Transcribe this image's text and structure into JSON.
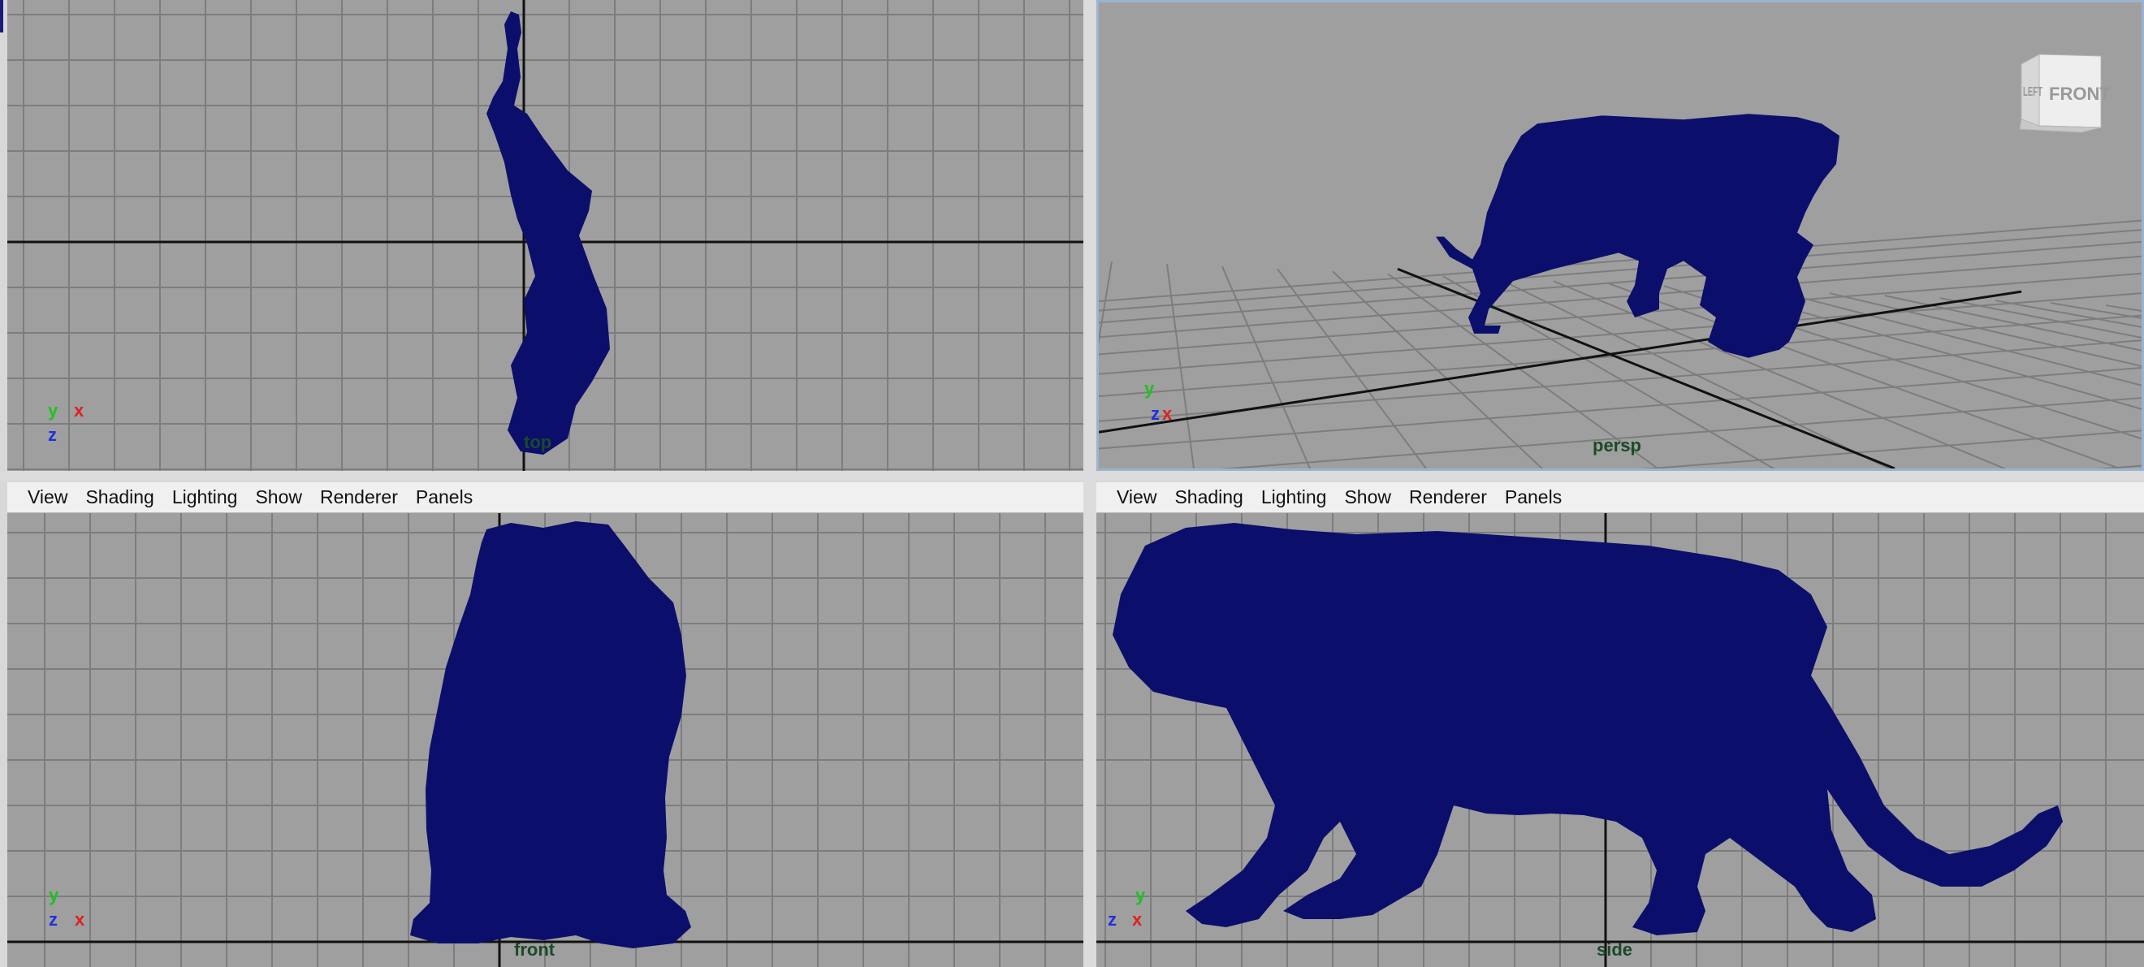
{
  "colors": {
    "viewport_bg": "#9f9f9f",
    "grid_line": "#7d7d7d",
    "axis_line": "#111111",
    "mesh": "#0b0f6b",
    "label_green": "#1a4a2a",
    "active_border": "#9bb3cf"
  },
  "menu": [
    "View",
    "Shading",
    "Lighting",
    "Show",
    "Renderer",
    "Panels"
  ],
  "viewports": {
    "top": {
      "camera_label": "top",
      "axis_labels": [
        "y",
        "x",
        "z"
      ]
    },
    "persp": {
      "camera_label": "persp",
      "axis_labels": [
        "y",
        "z",
        "x"
      ]
    },
    "front": {
      "camera_label": "front",
      "axis_labels": [
        "y",
        "z",
        "x"
      ]
    },
    "side": {
      "camera_label": "side",
      "axis_labels": [
        "y",
        "z",
        "x"
      ]
    }
  },
  "view_cube": {
    "left_face": "LEFT",
    "front_face": "FRONT"
  },
  "icons": [
    "view-cube-icon",
    "axis-gizmo-icon"
  ]
}
